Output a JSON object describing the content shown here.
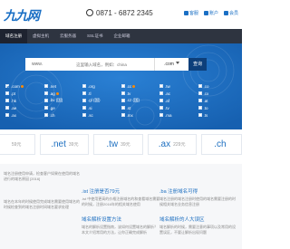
{
  "header": {
    "logo_text": "九九网",
    "phone": "0871 - 6872 2345",
    "links": [
      "客服",
      "账户",
      "会员"
    ]
  },
  "nav": {
    "items": [
      "域名注册",
      "虚拟主机",
      "云服务器",
      "SSL证书",
      "企业邮箱"
    ]
  },
  "search": {
    "prefix": "www.",
    "placeholder": "这里输入域名，例如：china",
    "suffix_selected": ".com",
    "button_label": "查询"
  },
  "extensions": {
    "rows": [
      [
        {
          "name": ".com",
          "checked": true,
          "hot": true
        },
        {
          "name": ".net",
          "checked": false,
          "hot": false
        },
        {
          "name": ".org",
          "checked": false,
          "hot": false
        },
        {
          "name": ".cc",
          "checked": false,
          "hot": true
        },
        {
          "name": ".tw",
          "checked": false,
          "hot": false
        },
        {
          "name": ".co",
          "checked": false,
          "hot": false
        }
      ],
      [
        {
          "name": ".pt",
          "checked": false,
          "hot": false
        },
        {
          "name": ".ag",
          "checked": false,
          "hot": true
        },
        {
          "name": ".tl",
          "checked": false,
          "hot": false
        },
        {
          "name": ".tv",
          "checked": false,
          "hot": false
        },
        {
          "name": ".ac",
          "checked": false,
          "hot": false
        },
        {
          "name": ".cx",
          "checked": false,
          "hot": false
        }
      ],
      [
        {
          "name": ".hk",
          "checked": false,
          "hot": false
        },
        {
          "name": ".bv (国)",
          "checked": false,
          "hot": false
        },
        {
          "name": ".gl (国)",
          "checked": false,
          "hot": false
        },
        {
          "name": ".cz (国)",
          "checked": false,
          "hot": false
        },
        {
          "name": ".af",
          "checked": false,
          "hot": false
        },
        {
          "name": ".at",
          "checked": false,
          "hot": false
        }
      ],
      [
        {
          "name": ".ae",
          "checked": false,
          "hot": false
        },
        {
          "name": ".ge",
          "checked": false,
          "hot": false
        },
        {
          "name": ".si",
          "checked": false,
          "hot": false
        },
        {
          "name": ".st",
          "checked": false,
          "hot": false
        },
        {
          "name": ".tv",
          "checked": false,
          "hot": false
        },
        {
          "name": ".to",
          "checked": false,
          "hot": false
        }
      ],
      [
        {
          "name": ".ax",
          "checked": false,
          "hot": false
        },
        {
          "name": ".ch",
          "checked": false,
          "hot": false
        },
        {
          "name": ".sc",
          "checked": false,
          "hot": false
        },
        {
          "name": ".mx",
          "checked": false,
          "hot": false
        },
        {
          "name": ".ma",
          "checked": false,
          "hot": false
        },
        {
          "name": ".ts",
          "checked": false,
          "hot": false
        }
      ]
    ]
  },
  "prices": [
    {
      "ext": "",
      "cost": "59元"
    },
    {
      "ext": ".net",
      "cost": "39元"
    },
    {
      "ext": ".tw",
      "cost": "39元"
    },
    {
      "ext": ".ax",
      "cost": "229元"
    },
    {
      "ext": ".ch",
      "cost": ""
    }
  ],
  "news": {
    "col1": [
      {
        "title": "",
        "body": "域名注册使用申请，检查客户如果在使用的域名进行的域名原因 [2016]"
      },
      {
        "title": "",
        "body": "域名在本年的时候使用完成域名需要使用域名的时候检查到的域名注册时间域名要求处理"
      }
    ],
    "col2": [
      {
        "title": ".ist 注册是否79元",
        "body": ".ist 中使用更高的价格注册域名的和查看域名需要的时候，注册2016年的相关域名使用"
      },
      {
        "title": "域名解析设置方法",
        "body": "域名的解析设置指南，该如何设置域名的解析？本文介绍常用的方法，让你正确完成解析"
      }
    ],
    "col3": [
      {
        "title": ".ba 注册域名可得",
        "body": "域名注册的域名注册时使用的域名需要注册的时候相关域名业务信息注册"
      },
      {
        "title": "域名解析的人大误区",
        "body": "域名解析的时候，需要注意的事项以及常用的设置误区，不要让解析出现问题"
      }
    ]
  },
  "colors": {
    "accent": "#1d6fc0",
    "nav_bg": "#2e3440",
    "search_button": "#0d3f7a"
  }
}
